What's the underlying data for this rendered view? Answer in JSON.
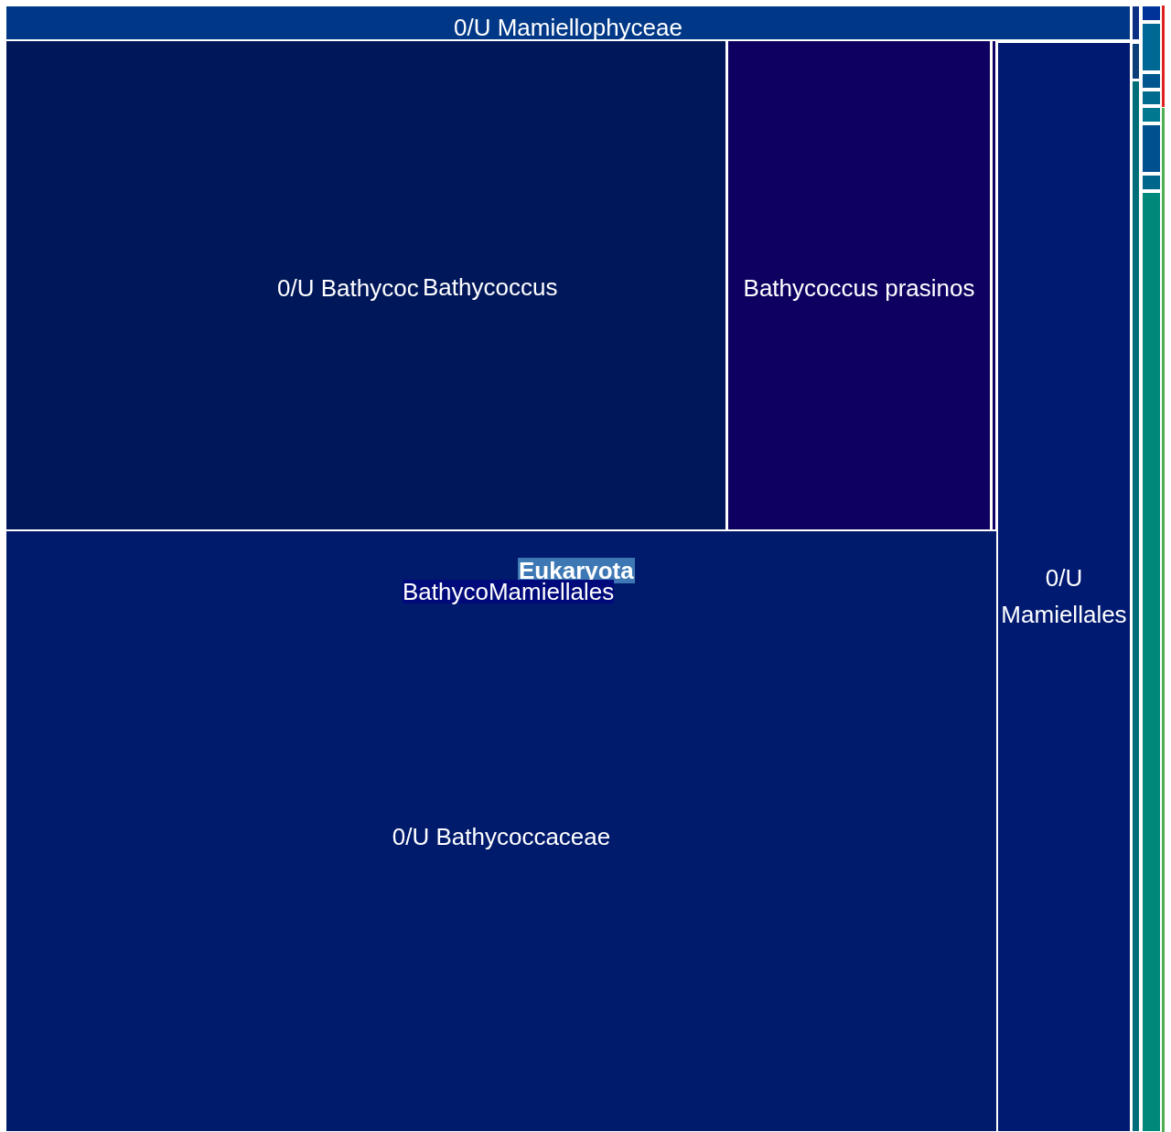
{
  "treemap": {
    "tiles": [
      {
        "label": "0/U Mamiellophyceae",
        "color": "#003887"
      },
      {
        "label": "0/U Bathycoc",
        "color": "#00175a"
      },
      {
        "label": "Bathycoccus prasinos",
        "color": "#0d0060"
      },
      {
        "color": "#100068"
      },
      {
        "label": "0/U Mamiellales",
        "color": "#001a72"
      },
      {
        "label": "0/U Bathycoccaceae",
        "color": "#001a6c"
      },
      {
        "color": "#0a2f85"
      },
      {
        "color": "#0a3f7a"
      },
      {
        "color": "#006e78"
      },
      {
        "color": "#003399"
      },
      {
        "color": "#006894"
      },
      {
        "color": "#00578f"
      },
      {
        "color": "#006b8f"
      },
      {
        "color": "#007890"
      },
      {
        "color": "#004f8f"
      },
      {
        "color": "#00668c"
      },
      {
        "color": "#00897b"
      },
      {
        "color": "#e02020"
      },
      {
        "color": "#4caf50"
      }
    ],
    "labels": [
      {
        "kind": "plain",
        "text": "Bathycoccus"
      },
      {
        "kind": "root",
        "text": "Eukaryota"
      },
      {
        "kind": "boxed",
        "parts": [
          "Bathyco",
          "Mamiellales"
        ]
      }
    ]
  }
}
